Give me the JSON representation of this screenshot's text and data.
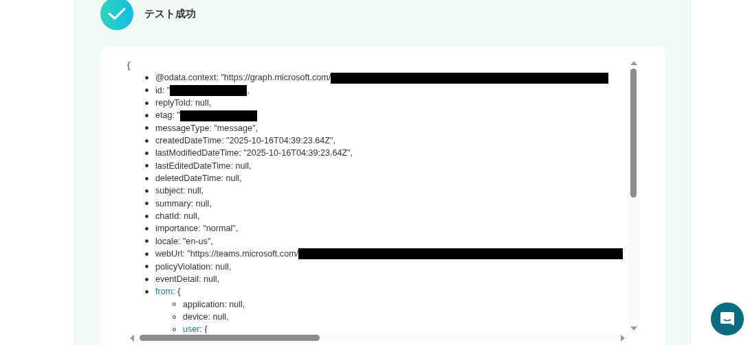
{
  "header": {
    "title": "テスト成功",
    "success": true
  },
  "code": {
    "open": "{",
    "items": [
      {
        "kind": "redacted_long",
        "text": "@odata.context: \"https://graph.microsoft.com/"
      },
      {
        "kind": "redacted_short",
        "text": "id: \"",
        "after": ","
      },
      {
        "kind": "plain",
        "text": "replyToId: null,"
      },
      {
        "kind": "redacted_short",
        "text": "etag: \""
      },
      {
        "kind": "plain",
        "text": "messageType: \"message\","
      },
      {
        "kind": "plain",
        "text": "createdDateTime: \"2025-10-16T04:39:23.64Z\","
      },
      {
        "kind": "plain",
        "text": "lastModifiedDateTime: \"2025-10-16T04:39:23.64Z\","
      },
      {
        "kind": "plain",
        "text": "lastEditedDateTime: null,"
      },
      {
        "kind": "plain",
        "text": "deletedDateTime: null,"
      },
      {
        "kind": "plain",
        "text": "subject: null,"
      },
      {
        "kind": "plain",
        "text": "summary: null,"
      },
      {
        "kind": "plain",
        "text": "chatId: null,"
      },
      {
        "kind": "plain",
        "text": "importance: \"normal\","
      },
      {
        "kind": "plain",
        "text": "locale: \"en-us\","
      },
      {
        "kind": "redacted_wide",
        "text": "webUrl: \"https://teams.microsoft.com/"
      },
      {
        "kind": "plain",
        "text": "policyViolation: null,"
      },
      {
        "kind": "plain",
        "text": "eventDetail: null,"
      },
      {
        "kind": "object",
        "key": "from",
        "text": ": {",
        "children": [
          {
            "kind": "plain",
            "text": "application: null,"
          },
          {
            "kind": "plain",
            "text": "device: null,"
          },
          {
            "kind": "object",
            "key": "user",
            "text": ": {"
          }
        ]
      }
    ]
  }
}
